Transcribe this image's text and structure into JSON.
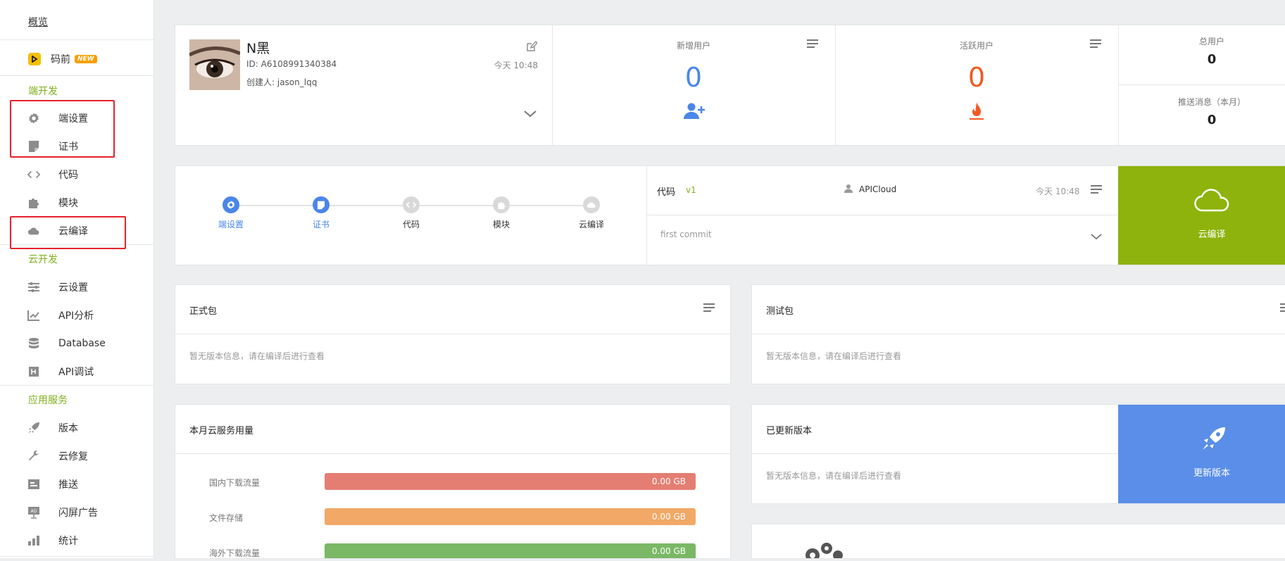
{
  "sidebar": {
    "overview": "概览",
    "mafront": {
      "label": "码前",
      "badge": "NEW"
    },
    "sections": [
      {
        "title": "端开发",
        "items": [
          {
            "label": "端设置",
            "icon": "gear-icon"
          },
          {
            "label": "证书",
            "icon": "certificate-icon"
          },
          {
            "label": "代码",
            "icon": "code-icon"
          },
          {
            "label": "模块",
            "icon": "puzzle-icon"
          },
          {
            "label": "云编译",
            "icon": "cloud-icon"
          }
        ]
      },
      {
        "title": "云开发",
        "items": [
          {
            "label": "云设置",
            "icon": "sliders-icon"
          },
          {
            "label": "API分析",
            "icon": "line-chart-icon"
          },
          {
            "label": "Database",
            "icon": "database-icon"
          },
          {
            "label": "API调试",
            "icon": "debug-icon"
          }
        ]
      },
      {
        "title": "应用服务",
        "items": [
          {
            "label": "版本",
            "icon": "rocket-icon"
          },
          {
            "label": "云修复",
            "icon": "wrench-icon"
          },
          {
            "label": "推送",
            "icon": "push-icon"
          },
          {
            "label": "闪屏广告",
            "icon": "ad-icon"
          },
          {
            "label": "统计",
            "icon": "bar-chart-icon"
          }
        ]
      }
    ]
  },
  "app": {
    "name": "N黑",
    "id": "ID: A6108991340384",
    "creator": "创建人: jason_lqq",
    "time": "今天 10:48"
  },
  "stats": {
    "new_users": {
      "label": "新增用户",
      "value": "0"
    },
    "active_users": {
      "label": "活跃用户",
      "value": "0"
    },
    "total_users": {
      "label": "总用户",
      "value": "0"
    },
    "push_month": {
      "label": "推送消息（本月）",
      "value": "0"
    }
  },
  "steps": [
    {
      "label": "端设置",
      "active": true
    },
    {
      "label": "证书",
      "active": true
    },
    {
      "label": "代码",
      "active": false
    },
    {
      "label": "模块",
      "active": false
    },
    {
      "label": "云编译",
      "active": false
    }
  ],
  "code": {
    "label": "代码",
    "version": "v1",
    "author": "APICloud",
    "time": "今天 10:48",
    "commit": "first commit"
  },
  "cloud_compile": {
    "label": "云编译",
    "color": "#8db30c"
  },
  "release_pkg": {
    "title": "正式包",
    "empty": "暂无版本信息，请在编译后进行查看"
  },
  "test_pkg": {
    "title": "测试包",
    "empty": "暂无版本信息，请在编译后进行查看"
  },
  "usage": {
    "title": "本月云服务用量",
    "rows": [
      {
        "label": "国内下载流量",
        "value": "0.00 GB",
        "color": "#e57e72"
      },
      {
        "label": "文件存储",
        "value": "0.00 GB",
        "color": "#f2a866"
      },
      {
        "label": "海外下载流量",
        "value": "0.00 GB",
        "color": "#7ab866"
      }
    ]
  },
  "updated": {
    "title": "已更新版本",
    "empty": "暂无版本信息，请在编译后进行查看"
  },
  "update_version": {
    "label": "更新版本",
    "color": "#5a8ee8"
  },
  "colors": {
    "accent_green": "#7fb01a",
    "accent_blue": "#4a86e8",
    "accent_orange": "#f05a22",
    "highlight": "#e8202a"
  }
}
